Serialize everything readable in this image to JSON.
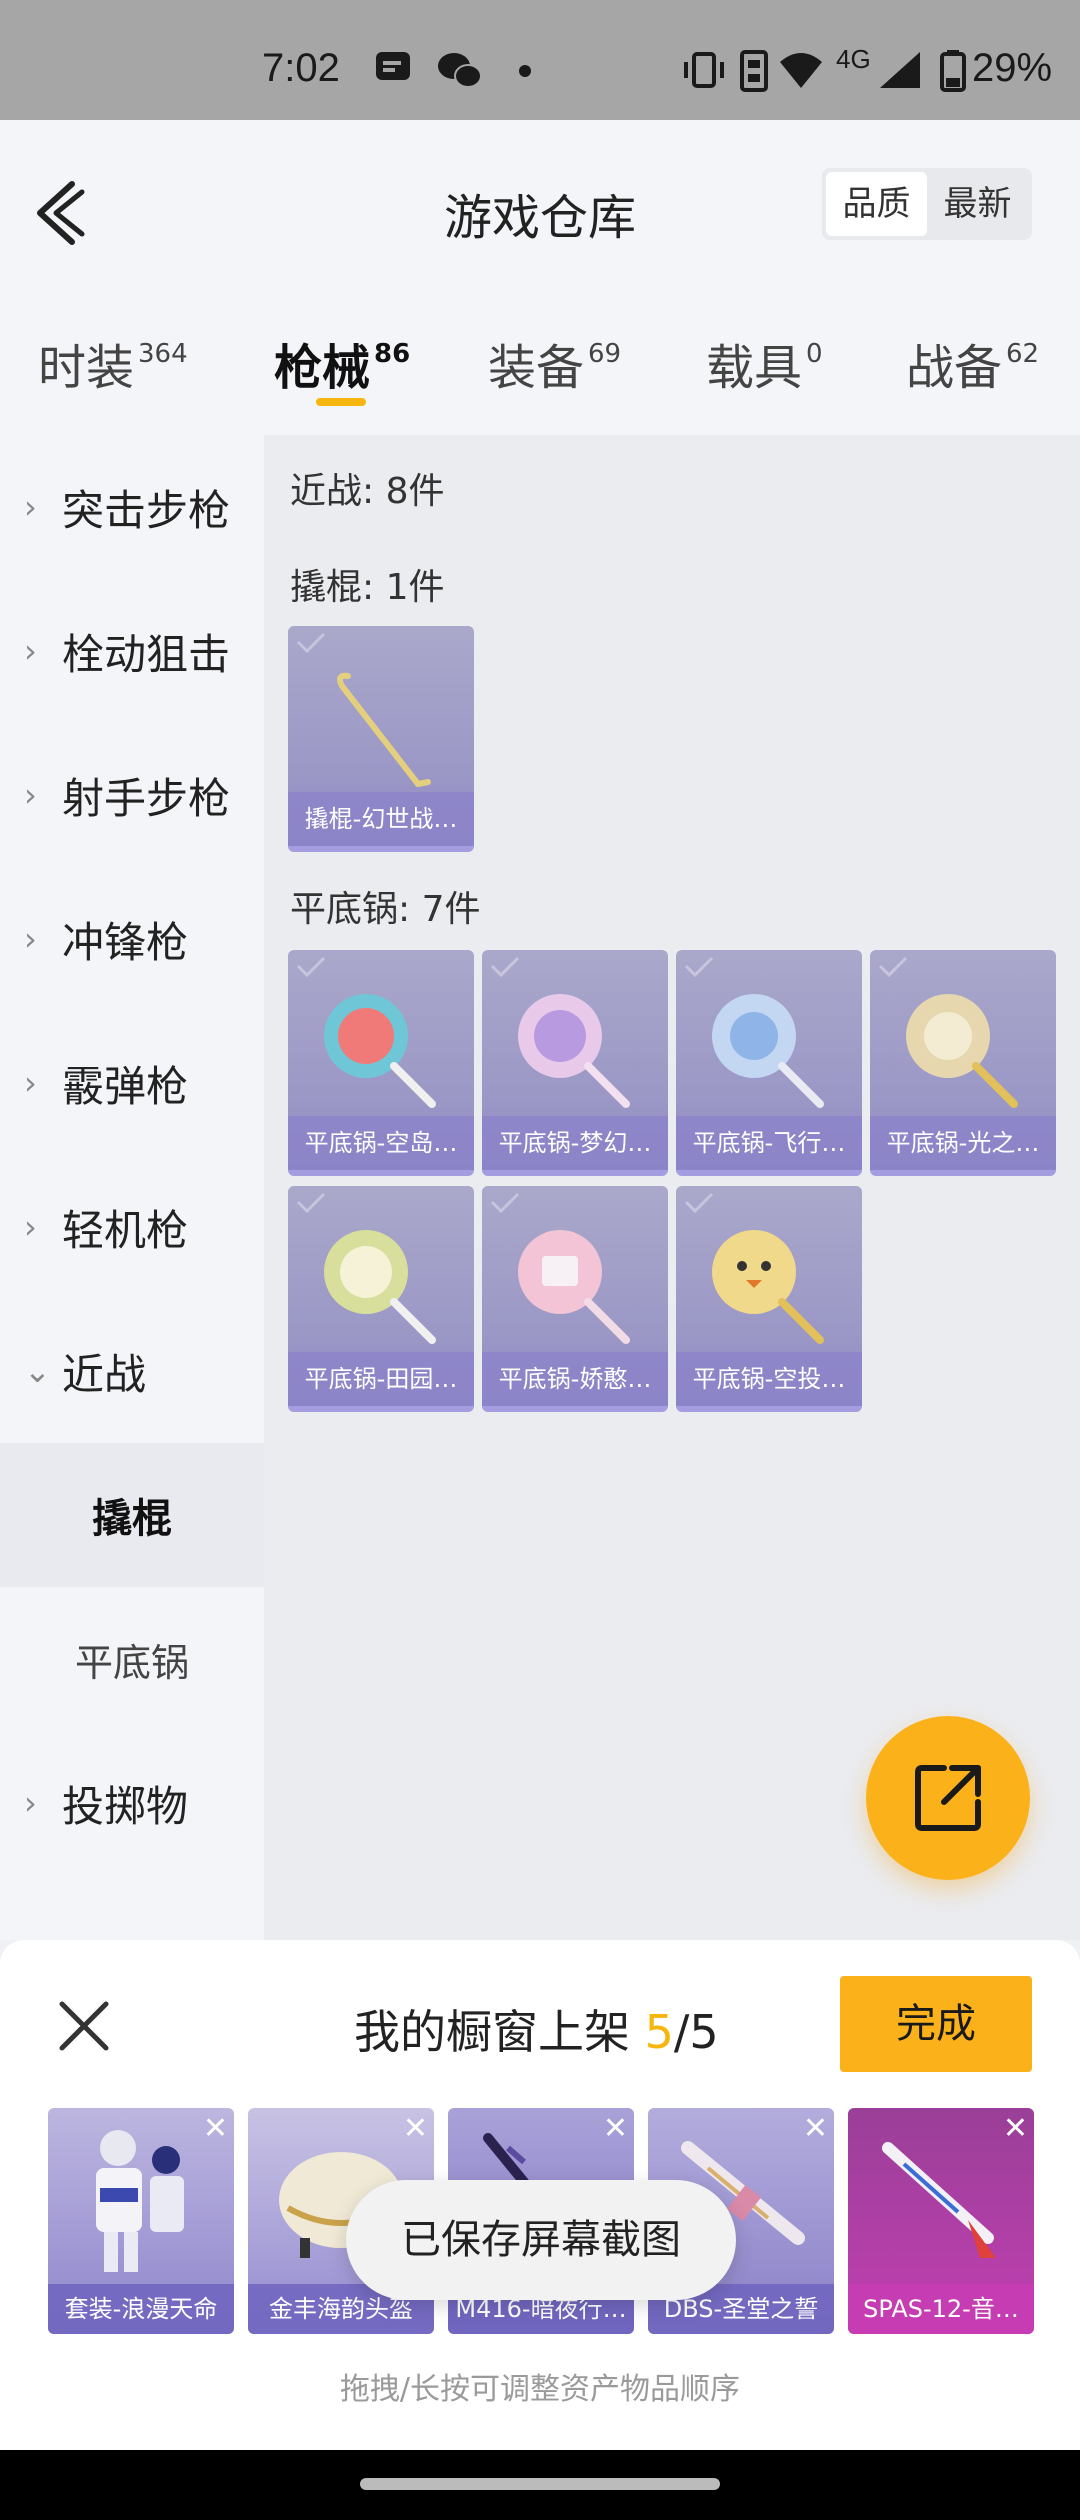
{
  "status": {
    "time": "7:02",
    "network": "4G",
    "battery": "29%",
    "icons": [
      "message-icon",
      "wechat-icon",
      "dot-icon",
      "vibrate-icon",
      "sim-icon",
      "wifi-icon",
      "signal-icon",
      "battery-icon"
    ]
  },
  "header": {
    "title": "游戏仓库",
    "sort_quality": "品质",
    "sort_newest": "最新"
  },
  "tabs": [
    {
      "label": "时装",
      "count": "364"
    },
    {
      "label": "枪械",
      "count": "86"
    },
    {
      "label": "装备",
      "count": "69"
    },
    {
      "label": "载具",
      "count": "0"
    },
    {
      "label": "战备",
      "count": "62"
    }
  ],
  "sidebar": {
    "items": [
      "突击步枪",
      "栓动狙击",
      "射手步枪",
      "冲锋枪",
      "霰弹枪",
      "轻机枪",
      "近战"
    ],
    "sub_items": [
      "撬棍",
      "平底锅"
    ],
    "last_item": "投掷物"
  },
  "content": {
    "section_melee": "近战: 8件",
    "section_crowbar": "撬棍: 1件",
    "section_pan": "平底锅: 7件",
    "crowbar_items": [
      "撬棍-幻世战…"
    ],
    "pan_items": [
      "平底锅-空岛…",
      "平底锅-梦幻…",
      "平底锅-飞行…",
      "平底锅-光之…",
      "平底锅-田园…",
      "平底锅-娇憨…",
      "平底锅-空投…"
    ]
  },
  "panel": {
    "title_prefix": "我的橱窗上架 ",
    "count_current": "5",
    "count_sep": "/",
    "count_total": "5",
    "done_label": "完成",
    "shelf_items": [
      "套装-浪漫天命",
      "金丰海韵头盔",
      "M416-暗夜行…",
      "DBS-圣堂之誓",
      "SPAS-12-音…"
    ],
    "hint": "拖拽/长按可调整资产物品顺序",
    "toast": "已保存屏幕截图"
  },
  "colors": {
    "accent": "#fbb21a",
    "card_purple": "#9a97c6",
    "shelf_pink": "#c13fb1"
  }
}
